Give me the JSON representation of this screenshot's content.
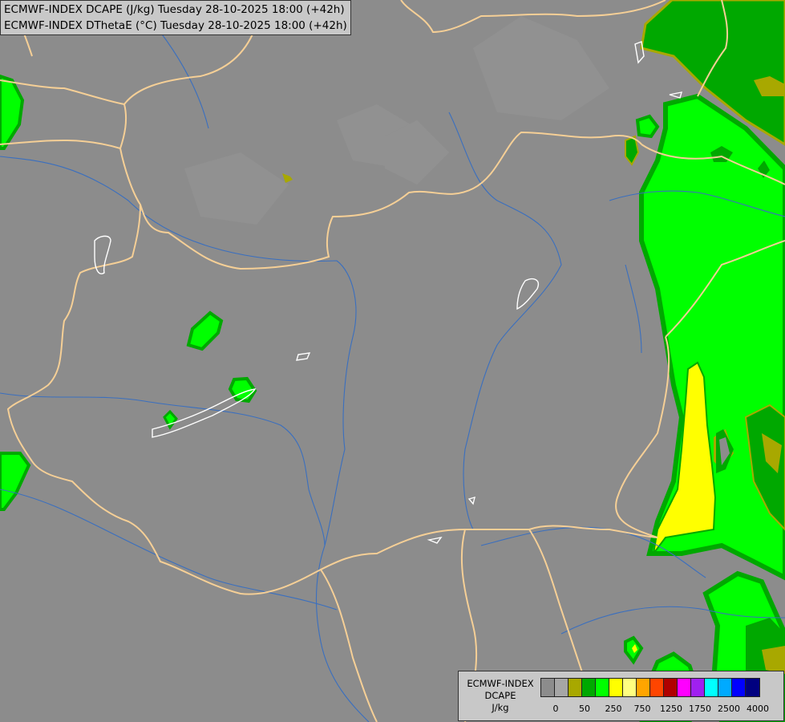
{
  "titles": [
    "ECMWF-INDEX DCAPE (J/kg) Tuesday 28-10-2025 18:00 (+42h)",
    "ECMWF-INDEX DThetaE (°C) Tuesday 28-10-2025 18:00 (+42h)"
  ],
  "legend": {
    "model": "ECMWF-INDEX",
    "parameter": "DCAPE",
    "unit": "J/kg",
    "colors": [
      "#8c8c8c",
      "#a6a6a6",
      "#a8a800",
      "#00a800",
      "#00ff00",
      "#ffff00",
      "#ffff80",
      "#ffa500",
      "#ff4500",
      "#b00000",
      "#ff00ff",
      "#a020f0",
      "#00ffff",
      "#00aaff",
      "#0000ff",
      "#000080"
    ],
    "tick_labels": [
      "0",
      "50",
      "250",
      "750",
      "1250",
      "1750",
      "2500",
      "4000"
    ]
  },
  "colors": {
    "background": "#8c8c8c",
    "border_lines": "#f5cf96",
    "rivers": "#3a6fbf",
    "lakes": "#ffffff"
  }
}
